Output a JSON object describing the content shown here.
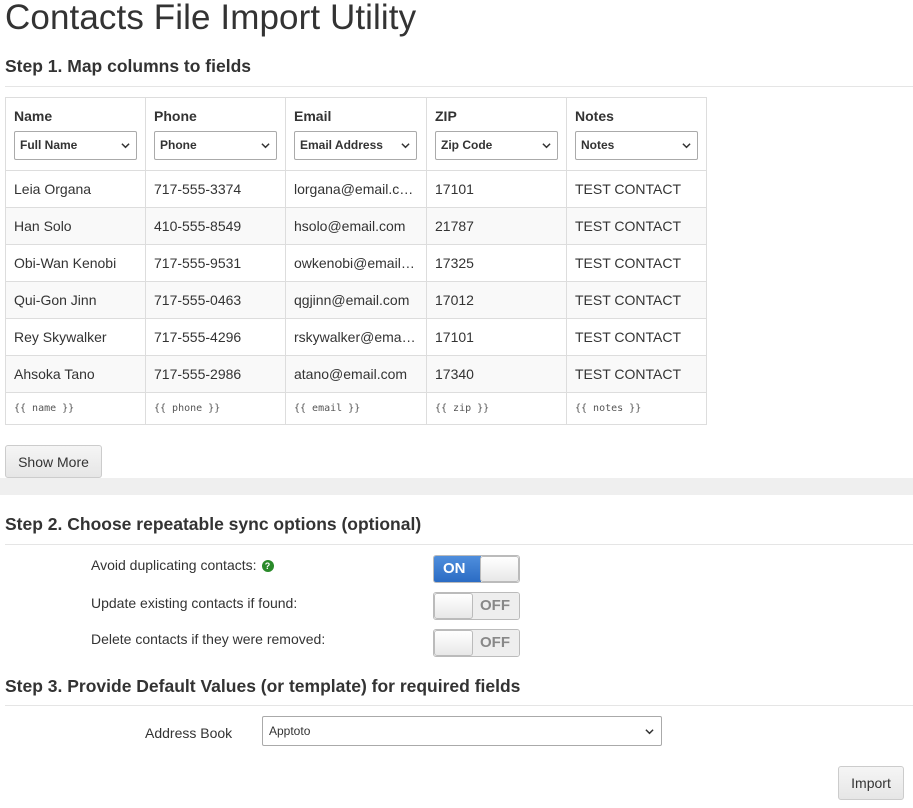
{
  "page": {
    "title": "Contacts File Import Utility"
  },
  "step1": {
    "heading": "Step 1. Map columns to fields",
    "columns": [
      {
        "header": "Name",
        "mapping": "Full Name"
      },
      {
        "header": "Phone",
        "mapping": "Phone"
      },
      {
        "header": "Email",
        "mapping": "Email Address"
      },
      {
        "header": "ZIP",
        "mapping": "Zip Code"
      },
      {
        "header": "Notes",
        "mapping": "Notes"
      }
    ],
    "rows": [
      [
        "Leia Organa",
        "717-555-3374",
        "lorgana@email.com",
        "17101",
        "TEST CONTACT"
      ],
      [
        "Han Solo",
        "410-555-8549",
        "hsolo@email.com",
        "21787",
        "TEST CONTACT"
      ],
      [
        "Obi-Wan Kenobi",
        "717-555-9531",
        "owkenobi@email.com",
        "17325",
        "TEST CONTACT"
      ],
      [
        "Qui-Gon Jinn",
        "717-555-0463",
        "qgjinn@email.com",
        "17012",
        "TEST CONTACT"
      ],
      [
        "Rey Skywalker",
        "717-555-4296",
        "rskywalker@email.com",
        "17101",
        "TEST CONTACT"
      ],
      [
        "Ahsoka Tano",
        "717-555-2986",
        "atano@email.com",
        "17340",
        "TEST CONTACT"
      ]
    ],
    "template_row": [
      "{{ name }}",
      "{{ phone }}",
      "{{ email }}",
      "{{ zip }}",
      "{{ notes }}"
    ],
    "show_more_label": "Show More"
  },
  "step2": {
    "heading": "Step 2. Choose repeatable sync options (optional)",
    "options": [
      {
        "label": "Avoid duplicating contacts:",
        "state": "ON",
        "has_help": true
      },
      {
        "label": "Update existing contacts if found:",
        "state": "OFF",
        "has_help": false
      },
      {
        "label": "Delete contacts if they were removed:",
        "state": "OFF",
        "has_help": false
      }
    ],
    "help_glyph": "?"
  },
  "step3": {
    "heading": "Step 3. Provide Default Values (or template) for required fields",
    "address_book_label": "Address Book",
    "address_book_value": "Apptoto",
    "import_label": "Import"
  },
  "colors": {
    "toggle_on": "#2b6cc4",
    "help_icon": "#2a8a2a"
  }
}
